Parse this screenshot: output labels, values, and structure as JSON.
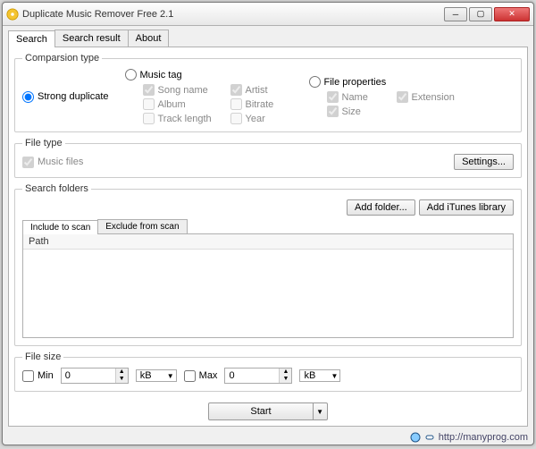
{
  "window": {
    "title": "Duplicate Music Remover Free 2.1"
  },
  "tabs": {
    "search": "Search",
    "result": "Search result",
    "about": "About"
  },
  "comparison": {
    "legend": "Comparsion type",
    "strong": "Strong duplicate",
    "musictag": "Music tag",
    "fileprops": "File properties",
    "opts": {
      "songname": "Song name",
      "artist": "Artist",
      "album": "Album",
      "bitrate": "Bitrate",
      "tracklength": "Track length",
      "year": "Year",
      "name": "Name",
      "extension": "Extension",
      "size": "Size"
    }
  },
  "filetype": {
    "legend": "File type",
    "music": "Music files",
    "settings": "Settings..."
  },
  "folders": {
    "legend": "Search folders",
    "add": "Add folder...",
    "itunes": "Add iTunes library",
    "include": "Include to scan",
    "exclude": "Exclude from scan",
    "pathcol": "Path"
  },
  "filesize": {
    "legend": "File size",
    "min": "Min",
    "max": "Max",
    "minval": "0",
    "maxval": "0",
    "unit": "kB"
  },
  "start": "Start",
  "footer": {
    "url": "http://manyprog.com"
  }
}
